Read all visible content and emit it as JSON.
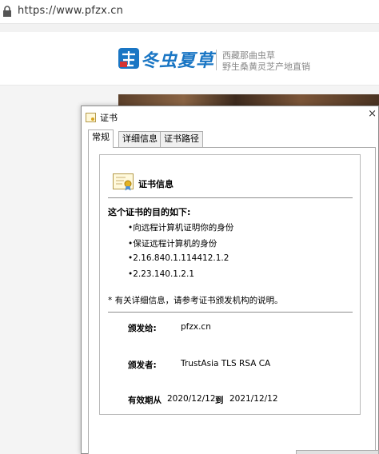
{
  "browser": {
    "url": "https://www.pfzx.cn"
  },
  "site": {
    "logo_text": "冬虫夏草",
    "slogan_line1": "西藏那曲虫草",
    "slogan_line2": "野生桑黄灵芝产地直销",
    "brand_color": "#1a76c4"
  },
  "dialog": {
    "title": "证书",
    "tabs": [
      {
        "label": "常规",
        "active": true
      },
      {
        "label": "详细信息",
        "active": false
      },
      {
        "label": "证书路径",
        "active": false
      }
    ],
    "cert_info_title": "证书信息",
    "purpose_heading": "这个证书的目的如下:",
    "purposes": [
      "•向远程计算机证明你的身份",
      "•保证远程计算机的身份",
      "•2.16.840.1.114412.1.2",
      "•2.23.140.1.2.1"
    ],
    "note": "* 有关详细信息，请参考证书颁发机构的说明。",
    "issued_to_label": "颁发给:",
    "issued_to_value": "pfzx.cn",
    "issued_by_label": "颁发者:",
    "issued_by_value": "TrustAsia TLS RSA CA",
    "valid_label": "有效期从",
    "valid_from": "2020/12/12",
    "valid_to_word": "到",
    "valid_to": "2021/12/12"
  }
}
